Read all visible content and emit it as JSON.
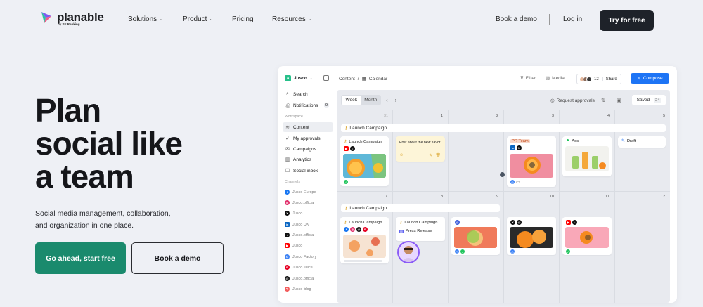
{
  "nav": {
    "logo_text": "planable",
    "logo_sub": "by SE Ranking",
    "items": [
      "Solutions",
      "Product",
      "Pricing",
      "Resources"
    ],
    "book_demo": "Book a demo",
    "login": "Log in",
    "try_free": "Try for free"
  },
  "hero": {
    "title_lines": [
      "Plan",
      "social like",
      "a team"
    ],
    "sub_lines": [
      "Social media management, collaboration,",
      "and organization in one place."
    ],
    "cta_primary": "Go ahead, start free",
    "cta_secondary": "Book a demo"
  },
  "app": {
    "workspace": "Jusco",
    "sidebar": {
      "search": "Search",
      "notifications": "Notifications",
      "notifications_count": "9",
      "workspace_section": "Workspace",
      "items": [
        "Content",
        "My approvals",
        "Campaigns",
        "Analytics",
        "Social inbox"
      ],
      "channels_section": "Channels",
      "channels": [
        "Jusco Europe",
        "Jusco.official",
        "Jusco",
        "Jusco UK",
        "Jusco.official",
        "Jusco",
        "Jusco Factory",
        "Jusco Juice",
        "Jusco.official",
        "Jusco-blog"
      ]
    },
    "topbar": {
      "crumb_root": "Content",
      "crumb_sep": "/",
      "crumb_view": "Calendar",
      "filter": "Filter",
      "media": "Media",
      "collab_count": "12",
      "share": "Share",
      "compose": "Compose"
    },
    "calendar": {
      "view_week": "Week",
      "view_month": "Month",
      "request_approvals": "Request approvals",
      "saved": "Saved",
      "saved_count": "24",
      "week1_days": [
        "31",
        "1",
        "2",
        "3",
        "4",
        "5"
      ],
      "week2_days": [
        "7",
        "8",
        "9",
        "10",
        "11",
        "12"
      ],
      "span1": "Launch Campaign",
      "span2": "Launch Campaign",
      "cards": {
        "c1": "Launch Campaign",
        "c2": "Post about the new flavor",
        "c3": "PR Team",
        "c4": "Ads",
        "c5": "Draft",
        "c6": "Launch Campaign",
        "c7": "Launch Campaign",
        "c7b": "Press Release"
      }
    }
  }
}
